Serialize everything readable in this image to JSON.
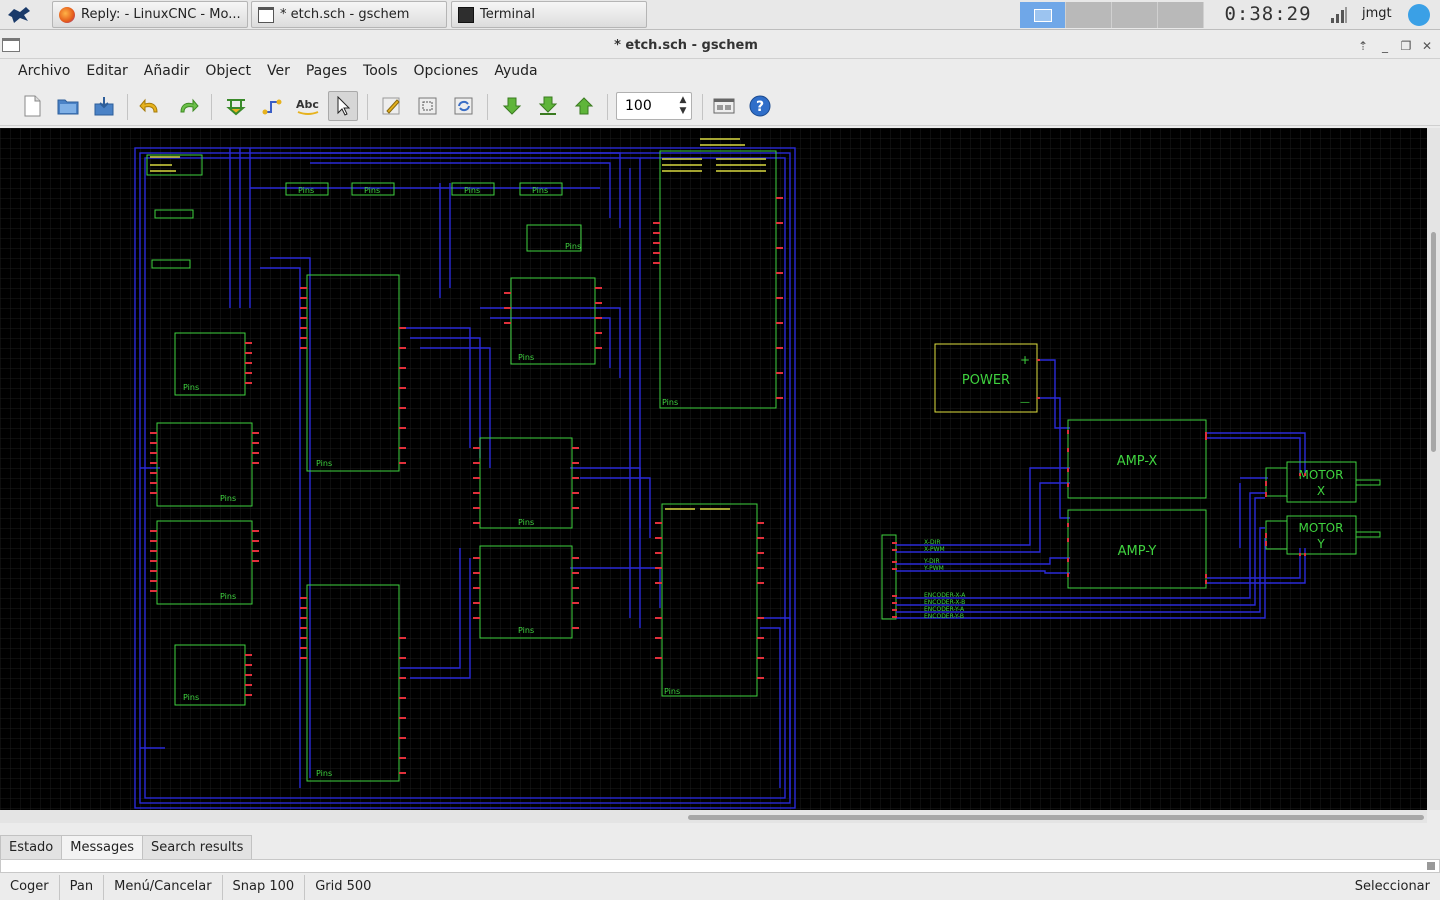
{
  "taskbar": {
    "tasks": [
      {
        "label": "Reply: - LinuxCNC - Mo...",
        "icon": "firefox-icon"
      },
      {
        "label": "* etch.sch - gschem",
        "icon": "window-icon"
      },
      {
        "label": "Terminal",
        "icon": "terminal-icon"
      }
    ],
    "clock": "0:38:29",
    "user": "jmgt"
  },
  "window": {
    "title": "* etch.sch - gschem"
  },
  "menu": [
    "Archivo",
    "Editar",
    "Añadir",
    "Object",
    "Ver",
    "Pages",
    "Tools",
    "Opciones",
    "Ayuda"
  ],
  "toolbar": {
    "icons": [
      "new-file-icon",
      "open-folder-icon",
      "save-icon",
      "undo-icon",
      "redo-icon",
      "add-component-icon",
      "add-net-icon",
      "add-text-icon",
      "select-icon",
      "edit-icon",
      "zoom-box-icon",
      "refresh-icon",
      "down-schematic-icon",
      "down-symbol-icon",
      "up-icon",
      "window-icon",
      "help-icon"
    ],
    "zoom_value": "100"
  },
  "schematic": {
    "blocks": [
      {
        "label": "POWER",
        "plus": "+",
        "minus": "—"
      },
      {
        "label": "AMP-X"
      },
      {
        "label": "AMP-Y"
      },
      {
        "label": "MOTOR\nX"
      },
      {
        "label": "MOTOR\nY"
      }
    ],
    "small_label": "Pins",
    "net_labels": [
      "X-DIR",
      "X-PWM",
      "Y-DIR",
      "Y-PWM",
      "ENCODER-X-A",
      "ENCODER-X-B",
      "ENCODER-Y-A",
      "ENCODER-Y-B"
    ],
    "colors": {
      "wire": "#2a2ad8",
      "component": "#3fd23f",
      "pin": "#e0303b",
      "text": "#e0e040",
      "grid": "#1a1a1a"
    }
  },
  "tabs": [
    "Estado",
    "Messages",
    "Search results"
  ],
  "active_tab": "Messages",
  "status": {
    "items": [
      "Coger",
      "Pan",
      "Menú/Cancelar",
      "Snap 100",
      "Grid 500"
    ],
    "mode": "Seleccionar"
  }
}
